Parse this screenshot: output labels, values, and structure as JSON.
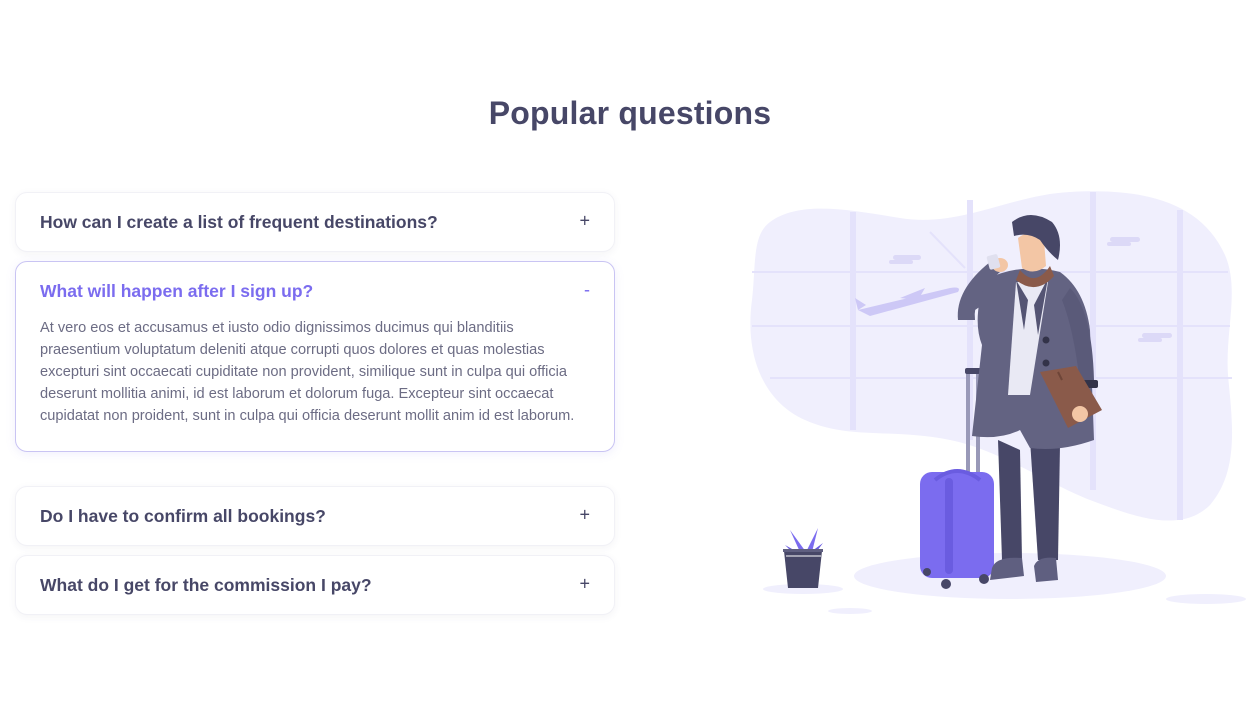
{
  "section": {
    "title": "Popular questions"
  },
  "faq": [
    {
      "question": "How can I create a list of frequent destinations?",
      "toggle": "+",
      "open": false
    },
    {
      "question": "What will happen after I sign up?",
      "toggle": "-",
      "open": true,
      "answer": "At vero eos et accusamus et iusto odio dignissimos ducimus qui blanditiis praesentium voluptatum deleniti atque corrupti quos dolores et quas molestias excepturi sint occaecati cupiditate non provident, similique sunt in culpa qui officia deserunt mollitia animi, id est laborum et dolorum fuga. Excepteur sint occaecat cupidatat non proident, sunt in culpa qui officia deserunt mollit anim id est laborum."
    },
    {
      "question": "Do I have to confirm all bookings?",
      "toggle": "+",
      "open": false
    },
    {
      "question": "What do I get for the commission I pay?",
      "toggle": "+",
      "open": false
    }
  ],
  "colors": {
    "heading": "#474767",
    "accent": "#7b6cef",
    "body_text": "#6c6c84",
    "blob": "#f0effd"
  },
  "illustration": {
    "icon": "traveler-with-suitcase-illustration"
  }
}
